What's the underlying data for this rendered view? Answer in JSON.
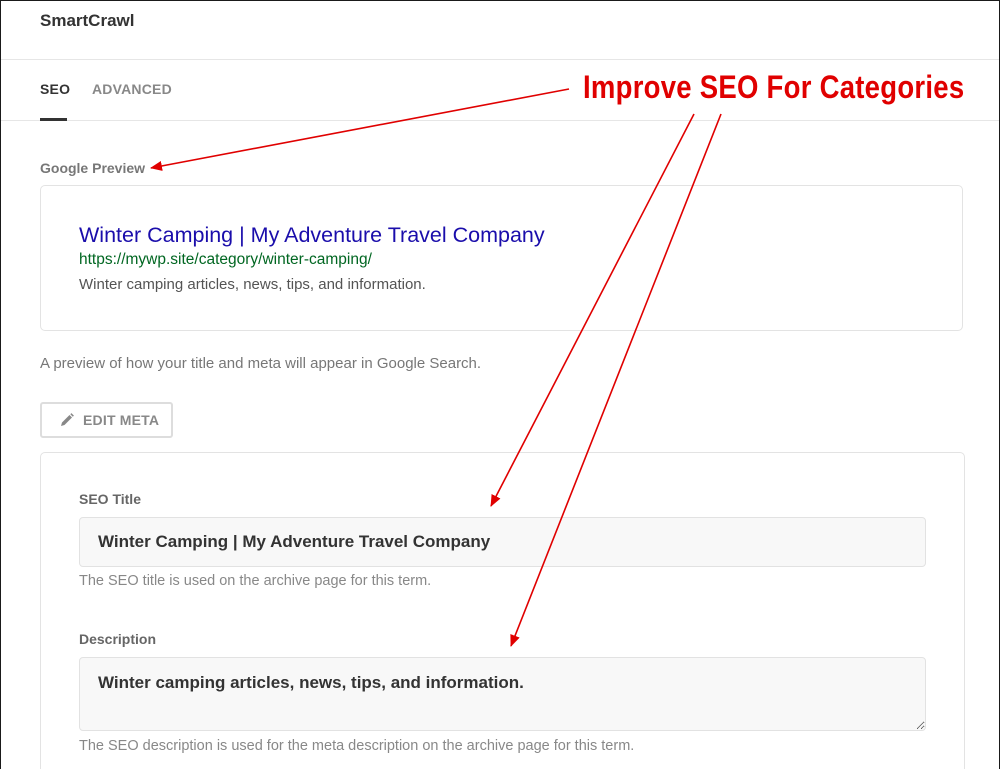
{
  "app": {
    "title": "SmartCrawl"
  },
  "tabs": [
    {
      "label": "SEO",
      "active": true
    },
    {
      "label": "ADVANCED",
      "active": false
    }
  ],
  "preview": {
    "section_label": "Google Preview",
    "title": "Winter Camping | My Adventure Travel Company",
    "url": "https://mywp.site/category/winter-camping/",
    "description": "Winter camping articles, news, tips, and information.",
    "help": "A preview of how your title and meta will appear in Google Search."
  },
  "edit_meta": {
    "label": "EDIT META",
    "icon": "pencil-icon"
  },
  "seo_title": {
    "label": "SEO Title",
    "value": "Winter Camping | My Adventure Travel Company",
    "help": "The SEO title is used on the archive page for this term."
  },
  "description": {
    "label": "Description",
    "value": "Winter camping articles, news, tips, and information.",
    "help": "The SEO description is used for the meta description on the archive page for this term."
  },
  "annotation": {
    "text": "Improve SEO For Categories",
    "color": "#e00000"
  },
  "colors": {
    "google_title": "#1a0dab",
    "google_url": "#006621",
    "google_desc": "#545454"
  }
}
